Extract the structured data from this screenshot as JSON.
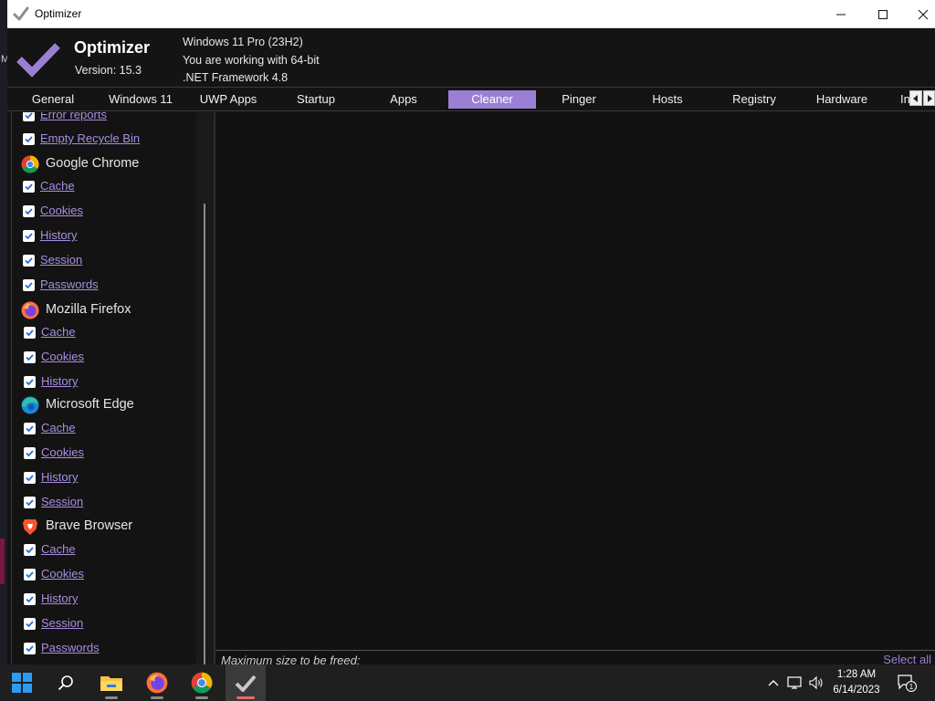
{
  "desktop": {
    "edge_text": "M"
  },
  "window": {
    "title": "Optimizer",
    "controls": [
      "minimize",
      "maximize",
      "close"
    ]
  },
  "header": {
    "app_name": "Optimizer",
    "version": "Version: 15.3",
    "os_line": "Windows 11 Pro (23H2)",
    "arch_line": "You are working with 64-bit",
    "framework_line": ".NET Framework 4.8"
  },
  "tabs": [
    {
      "label": "General",
      "active": false
    },
    {
      "label": "Windows 11",
      "active": false
    },
    {
      "label": "UWP Apps",
      "active": false
    },
    {
      "label": "Startup",
      "active": false
    },
    {
      "label": "Apps",
      "active": false
    },
    {
      "label": "Cleaner",
      "active": true
    },
    {
      "label": "Pinger",
      "active": false
    },
    {
      "label": "Hosts",
      "active": false
    },
    {
      "label": "Registry",
      "active": false
    },
    {
      "label": "Hardware",
      "active": false
    },
    {
      "label": "In",
      "active": false
    }
  ],
  "cleaner": {
    "items_top": [
      {
        "label": "Error reports",
        "checked": true
      },
      {
        "label": "Empty Recycle Bin",
        "checked": true
      }
    ],
    "groups": [
      {
        "name": "Google Chrome",
        "icon": "chrome-icon",
        "items": [
          {
            "label": "Cache",
            "checked": true
          },
          {
            "label": "Cookies",
            "checked": true
          },
          {
            "label": "History",
            "checked": true
          },
          {
            "label": "Session",
            "checked": true
          },
          {
            "label": "Passwords",
            "checked": true
          }
        ]
      },
      {
        "name": "Mozilla Firefox",
        "icon": "firefox-icon",
        "items": [
          {
            "label": "Cache",
            "checked": true
          },
          {
            "label": "Cookies",
            "checked": true
          },
          {
            "label": "History",
            "checked": true
          }
        ]
      },
      {
        "name": "Microsoft Edge",
        "icon": "edge-icon",
        "items": [
          {
            "label": "Cache",
            "checked": true
          },
          {
            "label": "Cookies",
            "checked": true
          },
          {
            "label": "History",
            "checked": true
          },
          {
            "label": "Session",
            "checked": true
          }
        ]
      },
      {
        "name": "Brave Browser",
        "icon": "brave-icon",
        "items": [
          {
            "label": "Cache",
            "checked": true
          },
          {
            "label": "Cookies",
            "checked": true
          },
          {
            "label": "History",
            "checked": true
          },
          {
            "label": "Session",
            "checked": true
          },
          {
            "label": "Passwords",
            "checked": true
          }
        ]
      }
    ],
    "max_size_label": "Maximum size to be freed:",
    "select_all_label": "Select all"
  },
  "taskbar": {
    "apps": [
      "start-icon",
      "search-icon",
      "file-explorer-icon",
      "firefox-icon",
      "chrome-icon",
      "optimizer-icon"
    ],
    "time": "1:28 AM",
    "date": "6/14/2023",
    "notification_count": "1"
  },
  "colors": {
    "accent": "#9b7fd4",
    "link": "#a88ee0",
    "background": "#131313"
  }
}
